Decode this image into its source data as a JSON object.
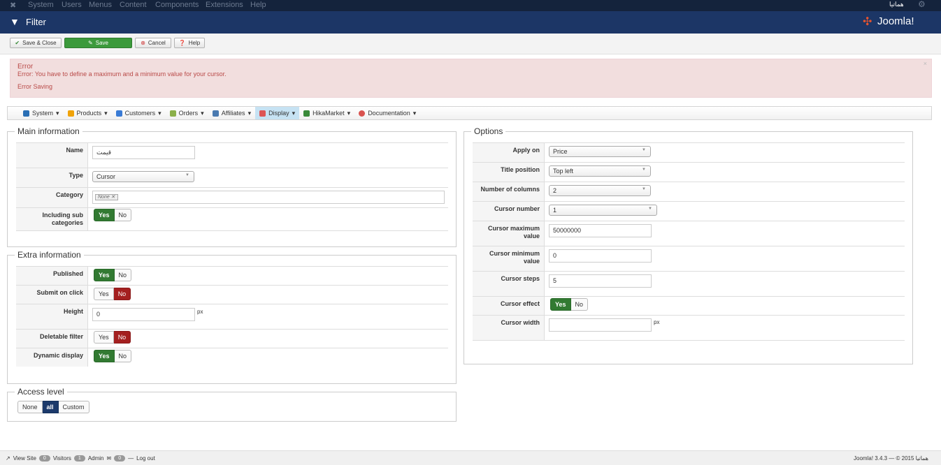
{
  "topbar": {
    "menu": [
      "System",
      "Users",
      "Menus",
      "Content",
      "Components",
      "Extensions",
      "Help"
    ],
    "user": "هماتیا"
  },
  "header": {
    "title": "Filter",
    "logo": "Joomla!"
  },
  "toolbar": {
    "save_close": "Save & Close",
    "save": "Save",
    "cancel": "Cancel",
    "help": "Help"
  },
  "error": {
    "heading": "Error",
    "message": "Error: You have to define a maximum and a minimum value for your cursor.",
    "detail": "Error Saving",
    "close": "×"
  },
  "menubar": [
    {
      "label": "System",
      "color": "#2a6fb5"
    },
    {
      "label": "Products",
      "color": "#f0a30a"
    },
    {
      "label": "Customers",
      "color": "#3a7bd5"
    },
    {
      "label": "Orders",
      "color": "#8bb04a"
    },
    {
      "label": "Affiliates",
      "color": "#4a7ab0"
    },
    {
      "label": "Display",
      "color": "#d55"
    },
    {
      "label": "HikaMarket",
      "color": "#3a8a3a"
    },
    {
      "label": "Documentation",
      "color": "#d9534f"
    }
  ],
  "main": {
    "legend": "Main information",
    "name_label": "Name",
    "name_value": "قیمت",
    "type_label": "Type",
    "type_value": "Cursor",
    "category_label": "Category",
    "category_tag": "None",
    "sub_label": "Including sub categories",
    "yes": "Yes",
    "no": "No"
  },
  "extra": {
    "legend": "Extra information",
    "published": "Published",
    "submit": "Submit on click",
    "height": "Height",
    "height_value": "0",
    "px": "px",
    "deletable": "Deletable filter",
    "dynamic": "Dynamic display"
  },
  "access": {
    "legend": "Access level",
    "none": "None",
    "all": "all",
    "custom": "Custom"
  },
  "options": {
    "legend": "Options",
    "apply_on": "Apply on",
    "apply_on_value": "Price",
    "title_position": "Title position",
    "title_position_value": "Top left",
    "columns": "Number of columns",
    "columns_value": "2",
    "cursor_number": "Cursor number",
    "cursor_number_value": "1",
    "max": "Cursor maximum value",
    "max_value": "50000000",
    "min": "Cursor minimum value",
    "min_value": "0",
    "steps": "Cursor steps",
    "steps_value": "5",
    "effect": "Cursor effect",
    "width": "Cursor width",
    "width_value": "",
    "px": "px"
  },
  "footer": {
    "view_site": "View Site",
    "visitors_count": "0",
    "visitors": "Visitors",
    "admin_count": "1",
    "admin": "Admin",
    "messages_count": "0",
    "logout": "Log out",
    "version": "Joomla! 3.4.3 — © 2015 هماتیا"
  }
}
